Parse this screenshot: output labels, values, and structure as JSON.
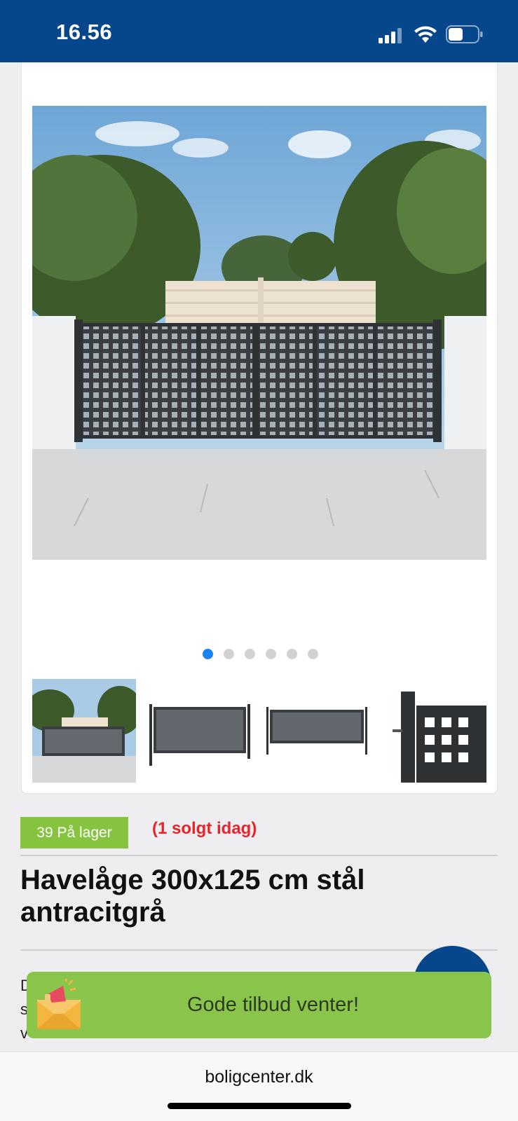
{
  "status_bar": {
    "time": "16.56",
    "battery_level": 0.5
  },
  "gallery": {
    "image_count": 6,
    "active_index": 0
  },
  "stock": {
    "badge": "39 På lager",
    "sold_today": "(1 solgt idag)"
  },
  "product": {
    "title": "Havelåge 300x125 cm stål antracitgrå"
  },
  "description": {
    "lines": [
      "D",
      "s",
      "v"
    ]
  },
  "promo": {
    "text": "Gode tilbud venter!"
  },
  "browser": {
    "url": "boligcenter.dk"
  },
  "colors": {
    "brand_blue": "#05478a",
    "stock_green": "#86c440",
    "sold_red": "#e8232b",
    "promo_green": "#89c44b",
    "dot_active": "#1a82f5"
  },
  "icons": [
    "signal-icon",
    "wifi-icon",
    "battery-icon",
    "megaphone-envelope-icon"
  ]
}
